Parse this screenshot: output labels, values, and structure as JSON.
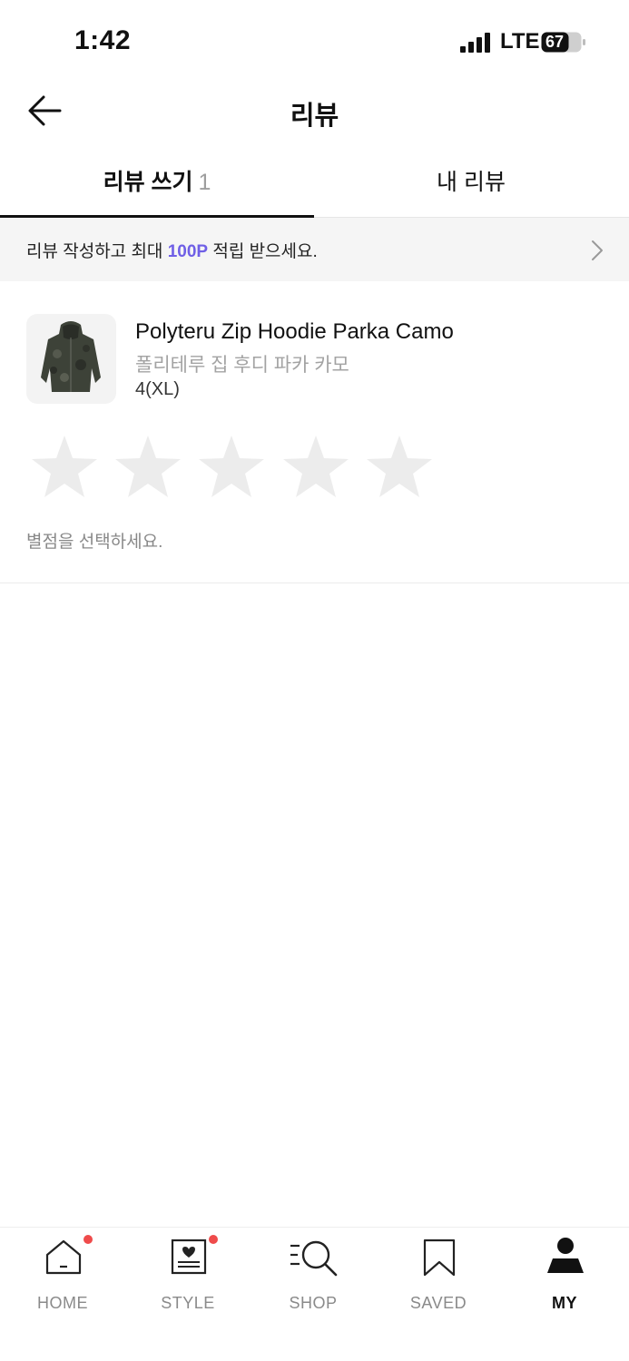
{
  "status_bar": {
    "time": "1:42",
    "network": "LTE",
    "battery": "67"
  },
  "header": {
    "title": "리뷰",
    "back_icon": "arrow-left-icon"
  },
  "tabs": [
    {
      "label": "리뷰 쓰기",
      "count": "1",
      "active": true
    },
    {
      "label": "내 리뷰",
      "active": false
    }
  ],
  "banner": {
    "text_before": "리뷰 작성하고 최대 ",
    "points": "100P",
    "text_after": " 적립 받으세요.",
    "accent_color": "#6f5fe6"
  },
  "product": {
    "name": "Polyteru Zip Hoodie Parka Camo",
    "name_kr": "폴리테루 집 후디 파카 카모",
    "size": "4(XL)"
  },
  "rating": {
    "stars_total": 5,
    "selected": 0,
    "hint": "별점을 선택하세요."
  },
  "bottom_nav": [
    {
      "label": "HOME",
      "icon": "home-icon",
      "badge": true,
      "active": false
    },
    {
      "label": "STYLE",
      "icon": "style-icon",
      "badge": true,
      "active": false
    },
    {
      "label": "SHOP",
      "icon": "shop-search-icon",
      "badge": false,
      "active": false
    },
    {
      "label": "SAVED",
      "icon": "bookmark-icon",
      "badge": false,
      "active": false
    },
    {
      "label": "MY",
      "icon": "profile-icon",
      "badge": false,
      "active": true
    }
  ]
}
